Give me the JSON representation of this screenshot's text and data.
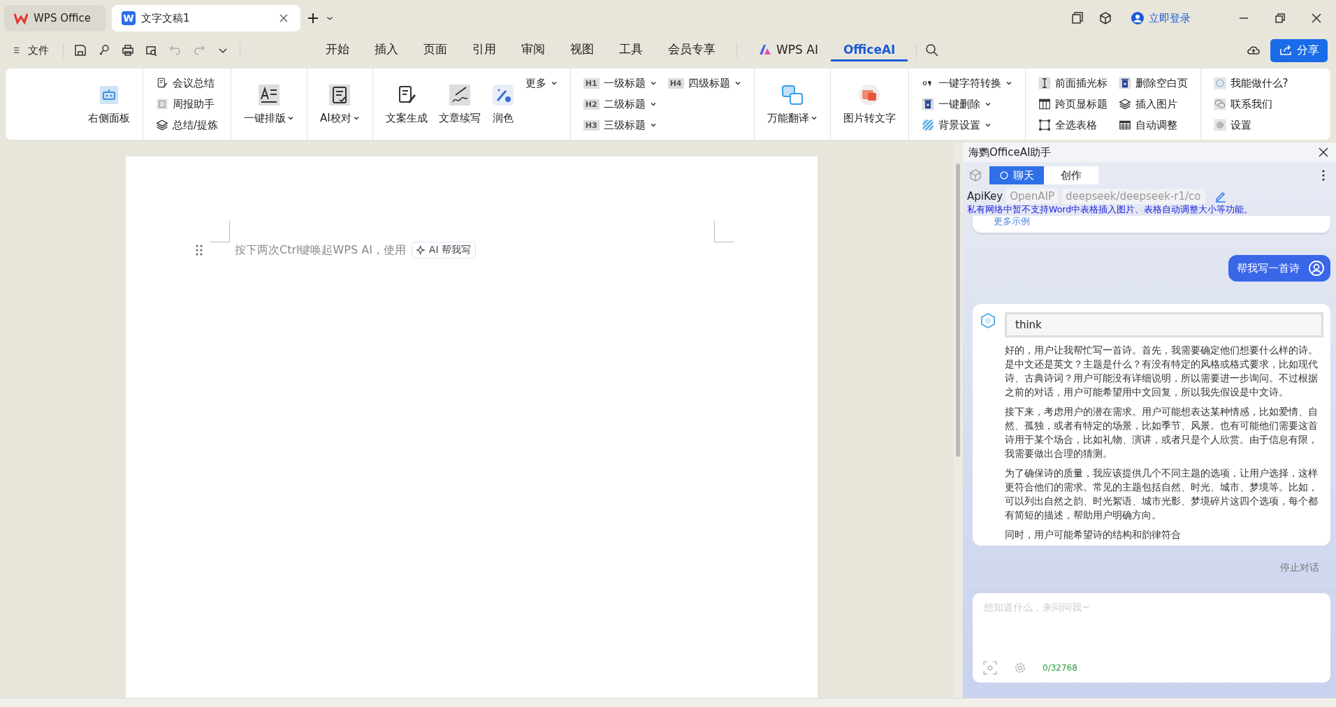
{
  "window_tabs": [
    {
      "label": "WPS Office",
      "selected": false,
      "closable": false
    },
    {
      "label": "文字文稿1",
      "selected": true,
      "closable": true,
      "badge": "W"
    }
  ],
  "account": {
    "label": "立即登录"
  },
  "quick_bar": {
    "file_label": "文件"
  },
  "menu_tabs": [
    {
      "label": "开始",
      "kind": "plain",
      "selected": false
    },
    {
      "label": "插入",
      "kind": "plain",
      "selected": false
    },
    {
      "label": "页面",
      "kind": "plain",
      "selected": false
    },
    {
      "label": "引用",
      "kind": "plain",
      "selected": false
    },
    {
      "label": "审阅",
      "kind": "plain",
      "selected": false
    },
    {
      "label": "视图",
      "kind": "plain",
      "selected": false
    },
    {
      "label": "工具",
      "kind": "plain",
      "selected": false
    },
    {
      "label": "会员专享",
      "kind": "plain",
      "selected": false
    },
    {
      "label": "WPS AI",
      "kind": "logo",
      "selected": false
    },
    {
      "label": "OfficeAI",
      "kind": "plain",
      "selected": true
    }
  ],
  "share_button": {
    "label": "分享"
  },
  "ribbon": {
    "groups": [
      {
        "items": [
          {
            "kind": "large",
            "label": "右侧面板",
            "dropdown": false
          }
        ]
      },
      {
        "items": [
          {
            "kind": "small",
            "label": "会议总结",
            "dropdown": false
          },
          {
            "kind": "small",
            "label": "周报助手",
            "dropdown": false
          },
          {
            "kind": "small",
            "label": "总结/提炼",
            "dropdown": false
          }
        ]
      },
      {
        "items": [
          {
            "kind": "large",
            "label": "一键排版",
            "dropdown": true
          }
        ]
      },
      {
        "items": [
          {
            "kind": "large",
            "label": "AI校对",
            "dropdown": true
          }
        ]
      },
      {
        "items": [
          {
            "kind": "large",
            "label": "文案生成",
            "dropdown": false
          },
          {
            "kind": "large",
            "label": "文章续写",
            "dropdown": false
          },
          {
            "kind": "large",
            "label": "润色",
            "dropdown": false
          },
          {
            "kind": "small",
            "label": "更多",
            "dropdown": true
          }
        ]
      },
      {
        "items": [
          {
            "kind": "small",
            "label": "一级标题",
            "dropdown": true,
            "badge": "H1"
          },
          {
            "kind": "small",
            "label": "二级标题",
            "dropdown": true,
            "badge": "H2"
          },
          {
            "kind": "small",
            "label": "三级标题",
            "dropdown": true,
            "badge": "H3"
          },
          {
            "kind": "small",
            "label": "四级标题",
            "dropdown": true,
            "badge": "H4"
          }
        ]
      },
      {
        "items": [
          {
            "kind": "large",
            "label": "万能翻译",
            "dropdown": true
          }
        ]
      },
      {
        "items": [
          {
            "kind": "large",
            "label": "图片转文字",
            "dropdown": false
          }
        ]
      },
      {
        "items": [
          {
            "kind": "small",
            "label": "一键字符转换",
            "dropdown": true
          },
          {
            "kind": "small",
            "label": "一键删除",
            "dropdown": true
          },
          {
            "kind": "small",
            "label": "背景设置",
            "dropdown": true
          }
        ]
      },
      {
        "items": [
          {
            "kind": "small",
            "label": "前面插光标",
            "dropdown": false
          },
          {
            "kind": "small",
            "label": "跨页显标题",
            "dropdown": false
          },
          {
            "kind": "small",
            "label": "全选表格",
            "dropdown": false
          },
          {
            "kind": "small",
            "label": "删除空白页",
            "dropdown": false
          },
          {
            "kind": "small",
            "label": "插入图片",
            "dropdown": false
          },
          {
            "kind": "small",
            "label": "自动调整",
            "dropdown": false
          }
        ]
      },
      {
        "items": [
          {
            "kind": "small",
            "label": "我能做什么?",
            "dropdown": false
          },
          {
            "kind": "small",
            "label": "联系我们",
            "dropdown": false
          },
          {
            "kind": "small",
            "label": "设置",
            "dropdown": false
          }
        ]
      }
    ]
  },
  "document": {
    "hint": "按下两次Ctrl键唤起WPS AI，使用",
    "ai_chip": "AI 帮我写"
  },
  "panel": {
    "title": "海鹦OfficeAI助手",
    "tabs": [
      {
        "label": "聊天",
        "selected": true
      },
      {
        "label": "创作",
        "selected": false
      }
    ],
    "apikey_label": "ApiKey",
    "provider": "OpenAIP",
    "model": "deepseek/deepseek-r1/co",
    "notice": "私有网络中暂不支持Word中表格插入图片、表格自动调整大小等功能。",
    "more_examples": "更多示例",
    "user_message": "帮我写一首诗",
    "think_label": "think",
    "paragraphs": [
      "好的，用户让我帮忙写一首诗。首先，我需要确定他们想要什么样的诗。是中文还是英文？主题是什么？有没有特定的风格或格式要求，比如现代诗、古典诗词？用户可能没有详细说明，所以需要进一步询问。不过根据之前的对话，用户可能希望用中文回复，所以我先假设是中文诗。",
      "接下来，考虑用户的潜在需求。用户可能想表达某种情感，比如爱情、自然、孤独，或者有特定的场景，比如季节、风景。也有可能他们需要这首诗用于某个场合，比如礼物、演讲，或者只是个人欣赏。由于信息有限，我需要做出合理的猜测。",
      "为了确保诗的质量，我应该提供几个不同主题的选项，让用户选择，这样更符合他们的需求。常见的主题包括自然、时光、城市、梦境等。比如，可以列出自然之韵、时光絮语、城市光影、梦境碎片这四个选项，每个都有简短的描述，帮助用户明确方向。",
      "同时，用户可能希望诗的结构和韵律符合"
    ],
    "stop_label": "停止对话",
    "input_placeholder": "想知道什么，来问问我~",
    "counter": "0/32768"
  }
}
